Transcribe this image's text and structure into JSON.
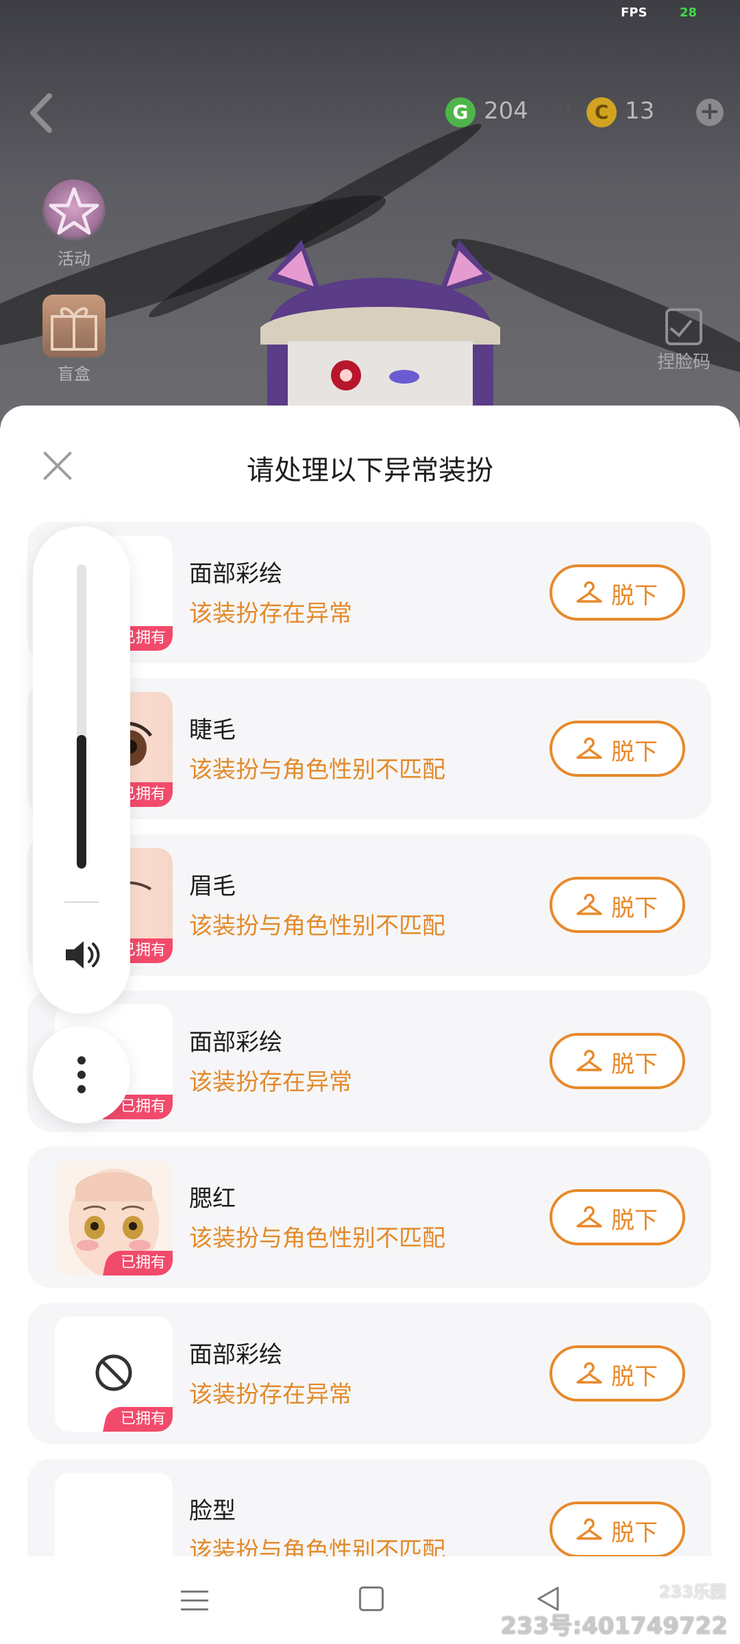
{
  "hud": {
    "fps_label": "FPS",
    "fps_value": "28",
    "currency_g_symbol": "G",
    "currency_g_value": "204",
    "currency_c_symbol": "C",
    "currency_c_value": "13",
    "add_symbol": "+"
  },
  "side_menu": {
    "activity_label": "活动",
    "blindbox_label": "盲盒",
    "face_code_label": "捏脸码"
  },
  "dialog": {
    "title": "请处理以下异常装扮",
    "remove_label": "脱下",
    "owned_label": "已拥有",
    "items": [
      {
        "name": "面部彩绘",
        "warning": "该装扮存在异常",
        "thumb": "face-paint"
      },
      {
        "name": "睫毛",
        "warning": "该装扮与角色性别不匹配",
        "thumb": "eyelash"
      },
      {
        "name": "眉毛",
        "warning": "该装扮与角色性别不匹配",
        "thumb": "eyebrow"
      },
      {
        "name": "面部彩绘",
        "warning": "该装扮存在异常",
        "thumb": "face-paint"
      },
      {
        "name": "腮红",
        "warning": "该装扮与角色性别不匹配",
        "thumb": "blush-face"
      },
      {
        "name": "面部彩绘",
        "warning": "该装扮存在异常",
        "thumb": "forbidden"
      },
      {
        "name": "脸型",
        "warning": "该装扮与角色性别不匹配",
        "thumb": "face-shape"
      }
    ]
  },
  "volume": {
    "level": 0.44
  },
  "colors": {
    "accent": "#e8892a",
    "badge": "#f24a6b",
    "card_bg": "#f6f6f8"
  },
  "watermark": {
    "brand": "233乐园",
    "id_text": "233号:401749722"
  }
}
